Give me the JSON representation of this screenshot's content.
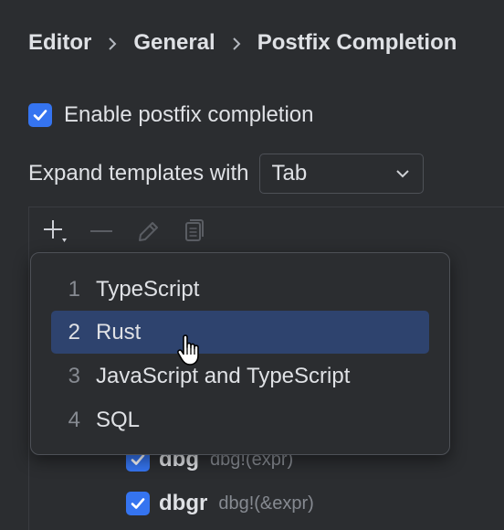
{
  "breadcrumb": [
    "Editor",
    "General",
    "Postfix Completion"
  ],
  "enable_postfix": {
    "label": "Enable postfix completion",
    "checked": true
  },
  "expand_templates": {
    "label": "Expand templates with",
    "value": "Tab"
  },
  "toolbar": {
    "icons": [
      "add-icon",
      "remove-icon",
      "edit-icon",
      "copy-icon"
    ]
  },
  "popup": {
    "items": [
      {
        "num": "1",
        "label": "TypeScript"
      },
      {
        "num": "2",
        "label": "Rust"
      },
      {
        "num": "3",
        "label": "JavaScript and TypeScript"
      },
      {
        "num": "4",
        "label": "SQL"
      }
    ],
    "selected_index": 1
  },
  "templates": [
    {
      "name": "dbg",
      "hint": "dbg!(expr)",
      "checked": true
    },
    {
      "name": "dbgr",
      "hint": "dbg!(&expr)",
      "checked": true
    }
  ],
  "colors": {
    "background": "#2b2d30",
    "accent": "#3574f0",
    "selection": "#2e436e",
    "text": "#dfe1e5",
    "muted": "#868a91"
  }
}
